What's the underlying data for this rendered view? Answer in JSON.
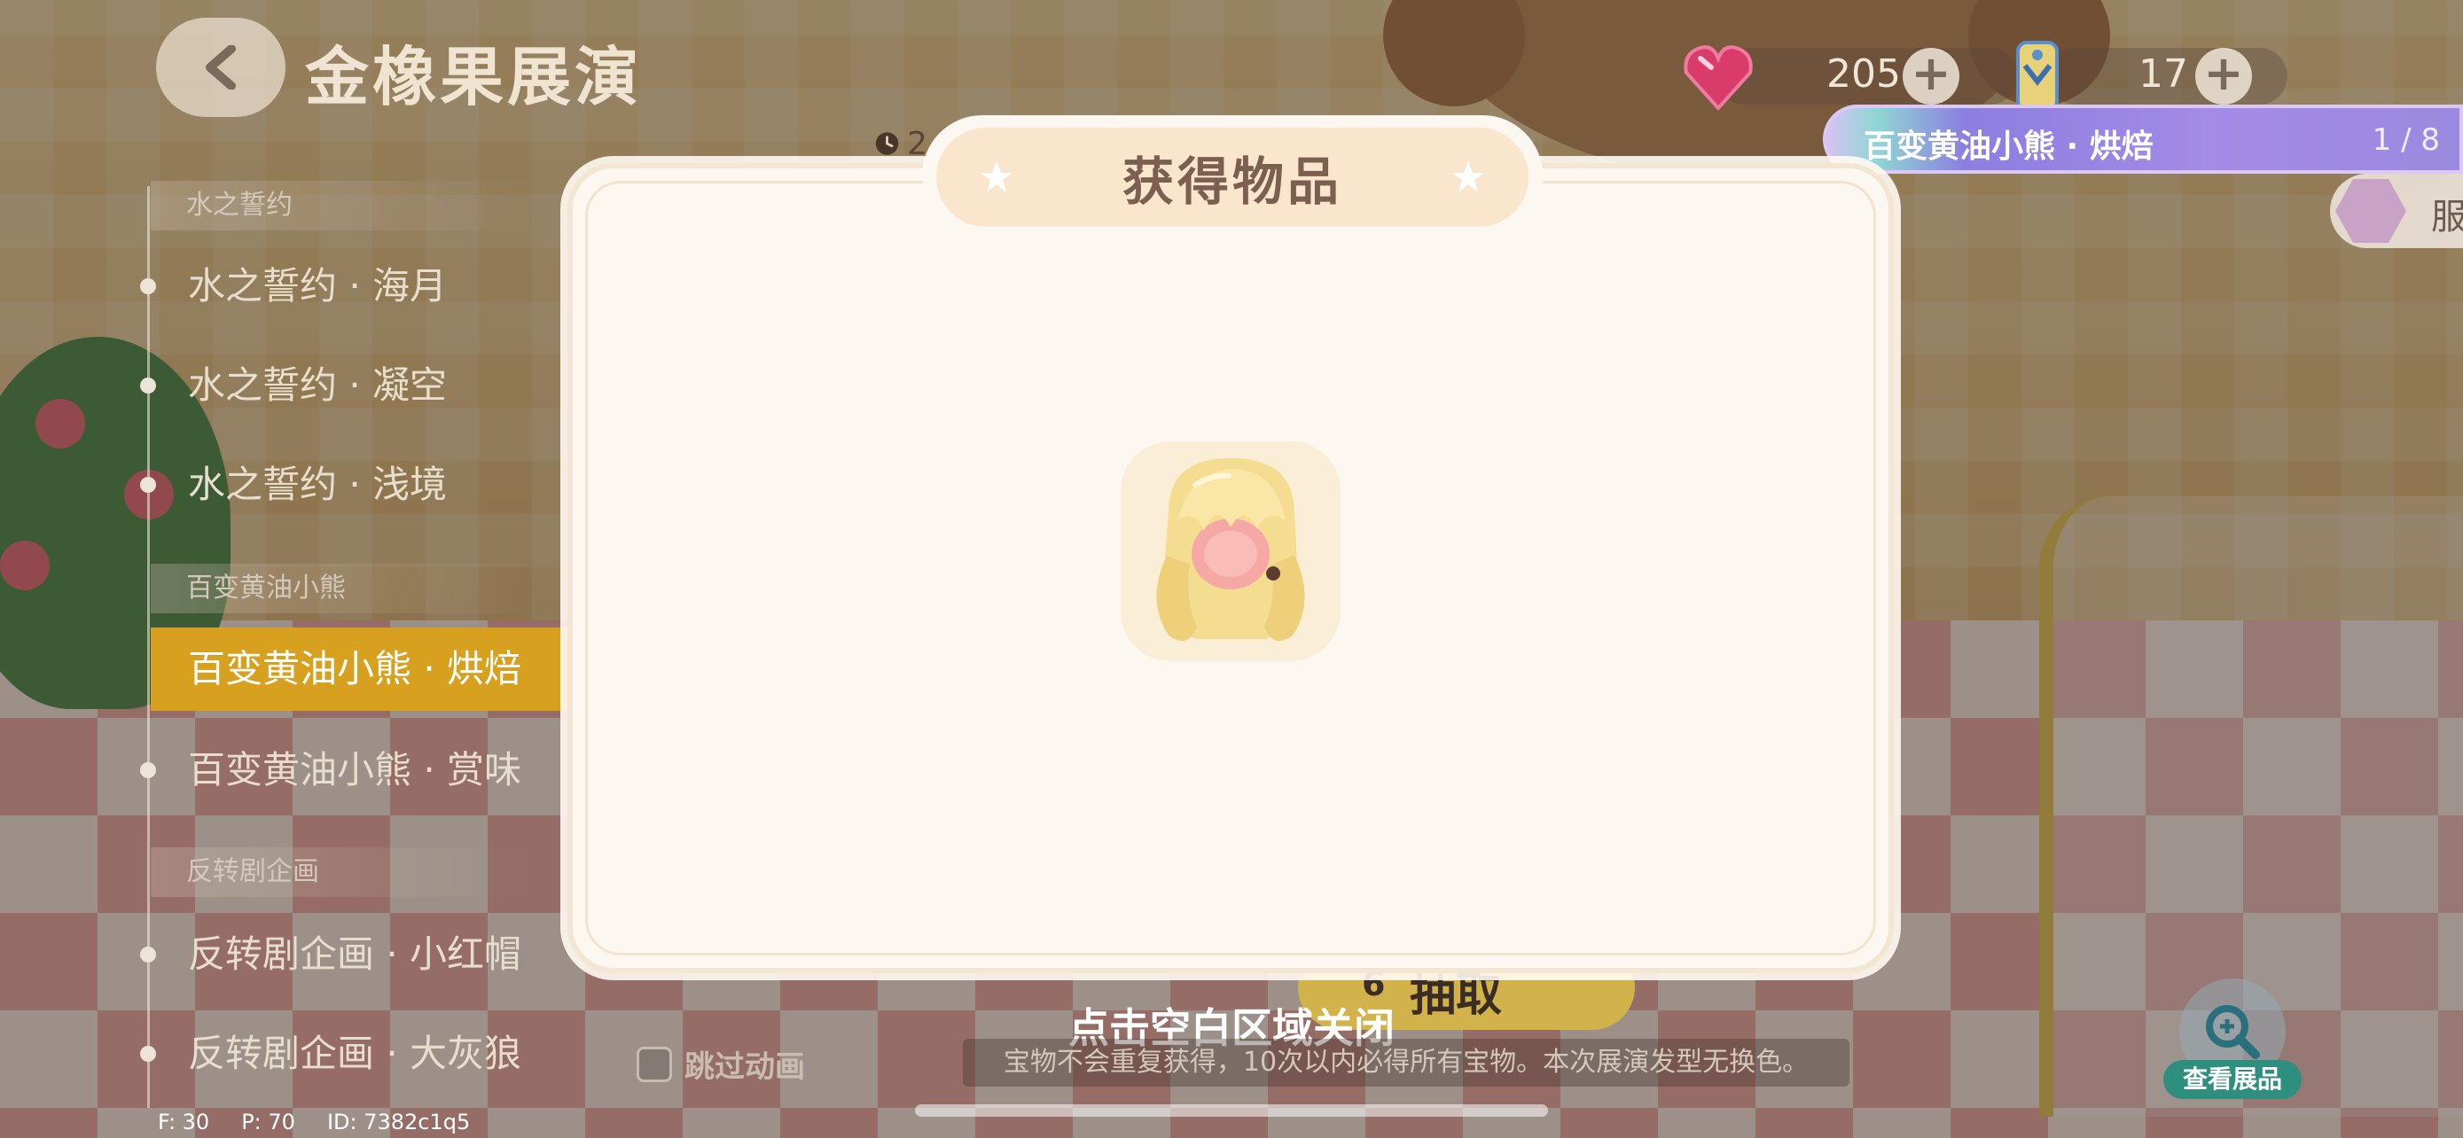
{
  "header": {
    "title": "金橡果展演",
    "gems": "205",
    "tickets": "17",
    "clock_text": "2"
  },
  "banner": {
    "label": "百变黄油小熊 · 烘焙",
    "count": "1 / 8"
  },
  "outfit_button": {
    "label": "服"
  },
  "sidebar": {
    "groups": [
      {
        "title": "水之誓约",
        "items": [
          "水之誓约 · 海月",
          "水之誓约 · 凝空",
          "水之誓约 · 浅境"
        ]
      },
      {
        "title": "百变黄油小熊",
        "items": [
          "百变黄油小熊 · 烘焙",
          "百变黄油小熊 · 赏味"
        ]
      },
      {
        "title": "反转剧企画",
        "items": [
          "反转剧企画 · 小红帽",
          "反转剧企画 · 大灰狼"
        ]
      }
    ],
    "active_item": "百变黄油小熊 · 烘焙"
  },
  "modal": {
    "title": "获得物品",
    "item_icon": "blonde-twin-tail-hair-icon"
  },
  "bottom": {
    "close_hint": "点击空白区域关闭",
    "rule_note": "宝物不会重复获得，10次以内必得所有宝物。本次展演发型无换色。",
    "skip_label": "跳过动画",
    "draw_cost": "6",
    "draw_label": "抽取",
    "view_label": "查看展品"
  },
  "debug": {
    "fps": "F: 30",
    "ping": "P: 70",
    "id": "ID: 7382c1q5"
  },
  "colors": {
    "accent_active": "#d7a01f",
    "modal_bg": "#fcf7f0",
    "modal_header": "#f9e6cc",
    "banner_purple": "#8c7ee0"
  }
}
